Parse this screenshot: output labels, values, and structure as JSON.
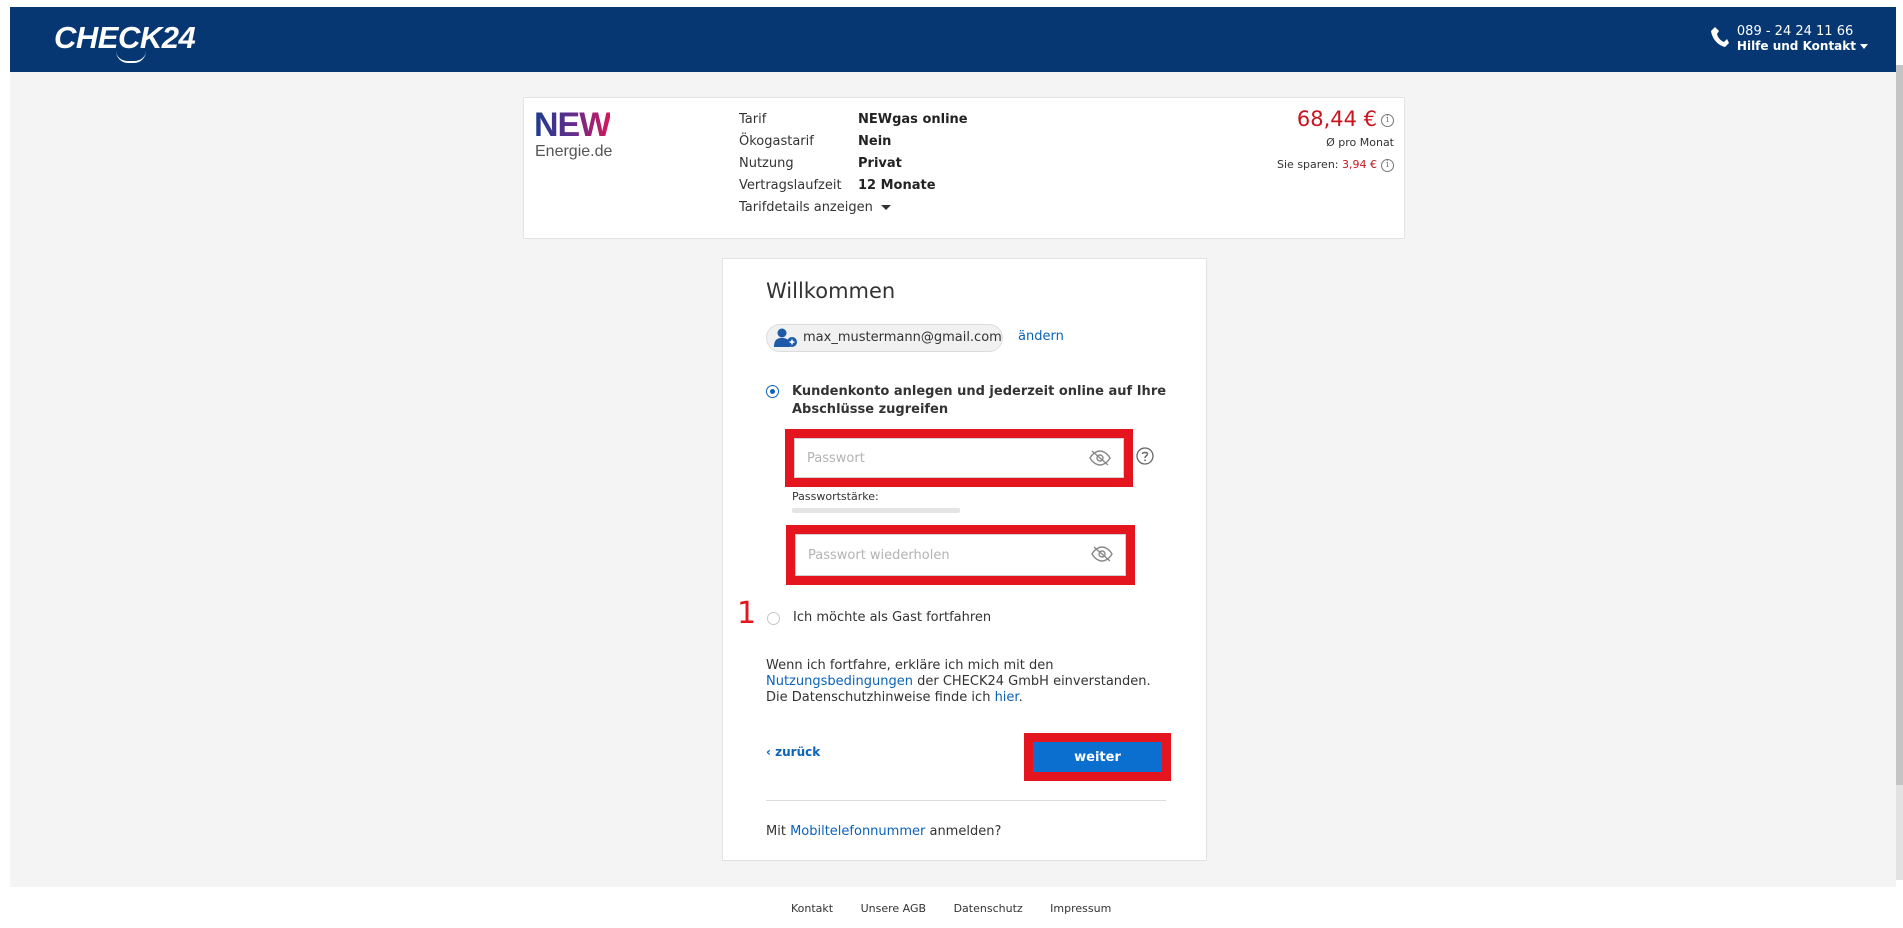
{
  "header": {
    "logo": "CHECK24",
    "phone": "089 - 24 24 11 66",
    "help": "Hilfe und Kontakt"
  },
  "tariff": {
    "provider_name": "NEW",
    "provider_sub": "Energie.de",
    "rows": [
      {
        "label": "Tarif",
        "value": "NEWgas online"
      },
      {
        "label": "Ökogastarif",
        "value": "Nein"
      },
      {
        "label": "Nutzung",
        "value": "Privat"
      },
      {
        "label": "Vertragslaufzeit",
        "value": "12 Monate"
      }
    ],
    "details_link": "Tarifdetails anzeigen",
    "price": "68,44 €",
    "price_sub": "Ø pro Monat",
    "save_label": "Sie sparen:",
    "save_amount": "3,94 €"
  },
  "login": {
    "title": "Willkommen",
    "email": "max_mustermann@gmail.com",
    "change": "ändern",
    "option_account": "Kundenkonto anlegen und jederzeit online auf Ihre Abschlüsse zugreifen",
    "password_placeholder": "Passwort",
    "strength_label": "Passwortstärke:",
    "password_repeat_placeholder": "Passwort wiederholen",
    "step_number": "1",
    "option_guest": "Ich möchte als Gast fortfahren",
    "terms_pre": "Wenn ich fortfahre, erkläre ich mich mit den ",
    "terms_link": "Nutzungsbedingungen",
    "terms_mid": " der CHECK24 GmbH einverstanden. Die Datenschutzhinweise finde ich ",
    "terms_link2": "hier",
    "terms_end": ".",
    "back": "zurück",
    "next": "weiter",
    "mobile_pre": "Mit ",
    "mobile_link": "Mobiltelefonnummer",
    "mobile_post": " anmelden?"
  },
  "footer": [
    "Kontakt",
    "Unsere AGB",
    "Datenschutz",
    "Impressum"
  ]
}
